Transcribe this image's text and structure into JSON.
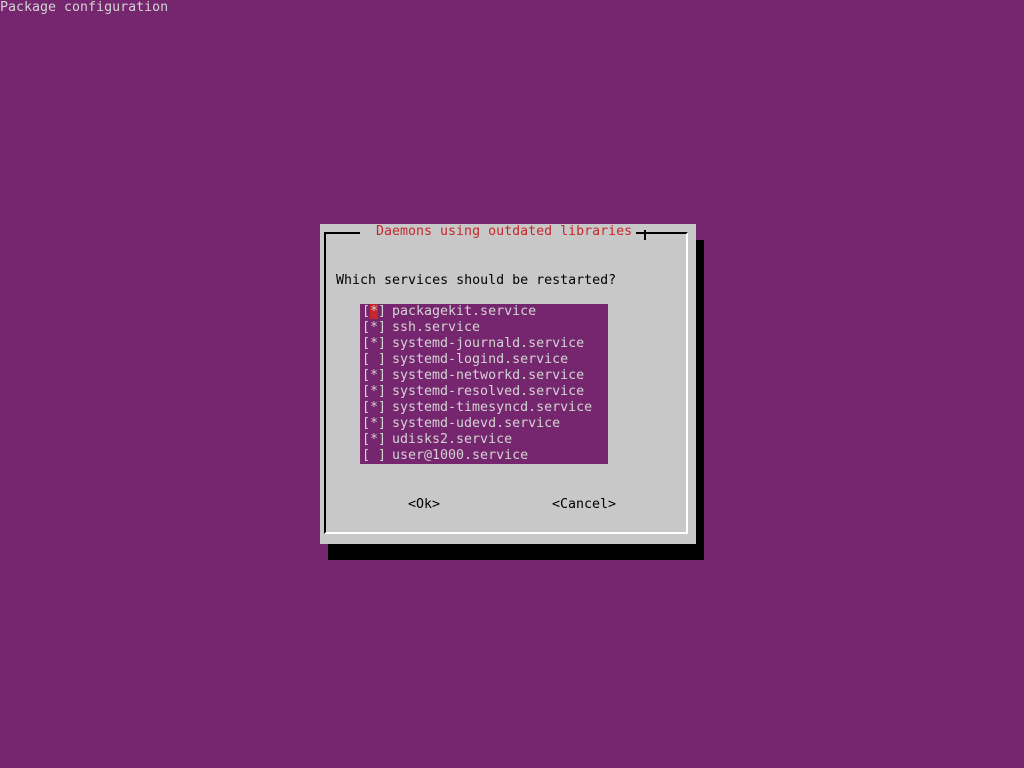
{
  "backtitle": "Package configuration",
  "dialog": {
    "title": "Daemons using outdated libraries",
    "question": "Which services should be restarted?",
    "items": [
      {
        "mark": "*",
        "label": "packagekit.service"
      },
      {
        "mark": "*",
        "label": "ssh.service"
      },
      {
        "mark": "*",
        "label": "systemd-journald.service"
      },
      {
        "mark": " ",
        "label": "systemd-logind.service"
      },
      {
        "mark": "*",
        "label": "systemd-networkd.service"
      },
      {
        "mark": "*",
        "label": "systemd-resolved.service"
      },
      {
        "mark": "*",
        "label": "systemd-timesyncd.service"
      },
      {
        "mark": "*",
        "label": "systemd-udevd.service"
      },
      {
        "mark": "*",
        "label": "udisks2.service"
      },
      {
        "mark": " ",
        "label": "user@1000.service"
      }
    ],
    "ok_label": "<Ok>",
    "cancel_label": "<Cancel>"
  },
  "colors": {
    "background": "#76266f",
    "dialog": "#c8c8c8",
    "accent": "#c4282d"
  }
}
